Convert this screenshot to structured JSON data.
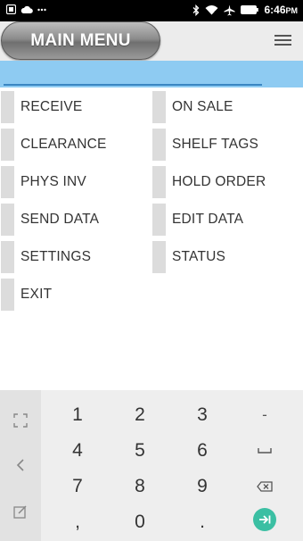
{
  "status_bar": {
    "time": "6:46",
    "ampm": "PM",
    "left_icons": [
      "notification-square-icon",
      "cloud-icon",
      "more-dots-icon"
    ],
    "right_icons": [
      "bluetooth-icon",
      "wifi-icon",
      "airplane-mode-icon",
      "battery-icon"
    ]
  },
  "header": {
    "title": "MAIN MENU",
    "menu_icon": "hamburger-menu-icon"
  },
  "search": {
    "value": "",
    "placeholder": ""
  },
  "menu": {
    "items": [
      {
        "label": "RECEIVE"
      },
      {
        "label": "ON SALE"
      },
      {
        "label": "CLEARANCE"
      },
      {
        "label": "SHELF TAGS"
      },
      {
        "label": "PHYS INV"
      },
      {
        "label": "HOLD ORDER"
      },
      {
        "label": "SEND DATA"
      },
      {
        "label": "EDIT DATA"
      },
      {
        "label": "SETTINGS"
      },
      {
        "label": "STATUS"
      },
      {
        "label": "EXIT"
      }
    ]
  },
  "keypad": {
    "keys": [
      "1",
      "2",
      "3",
      "-",
      "4",
      "5",
      "6",
      "␣",
      "7",
      "8",
      "9",
      "⌫",
      ",",
      "0",
      ".",
      "⇥"
    ],
    "side": [
      "expand-icon",
      "chevron-left-icon",
      "edit-icon"
    ]
  }
}
